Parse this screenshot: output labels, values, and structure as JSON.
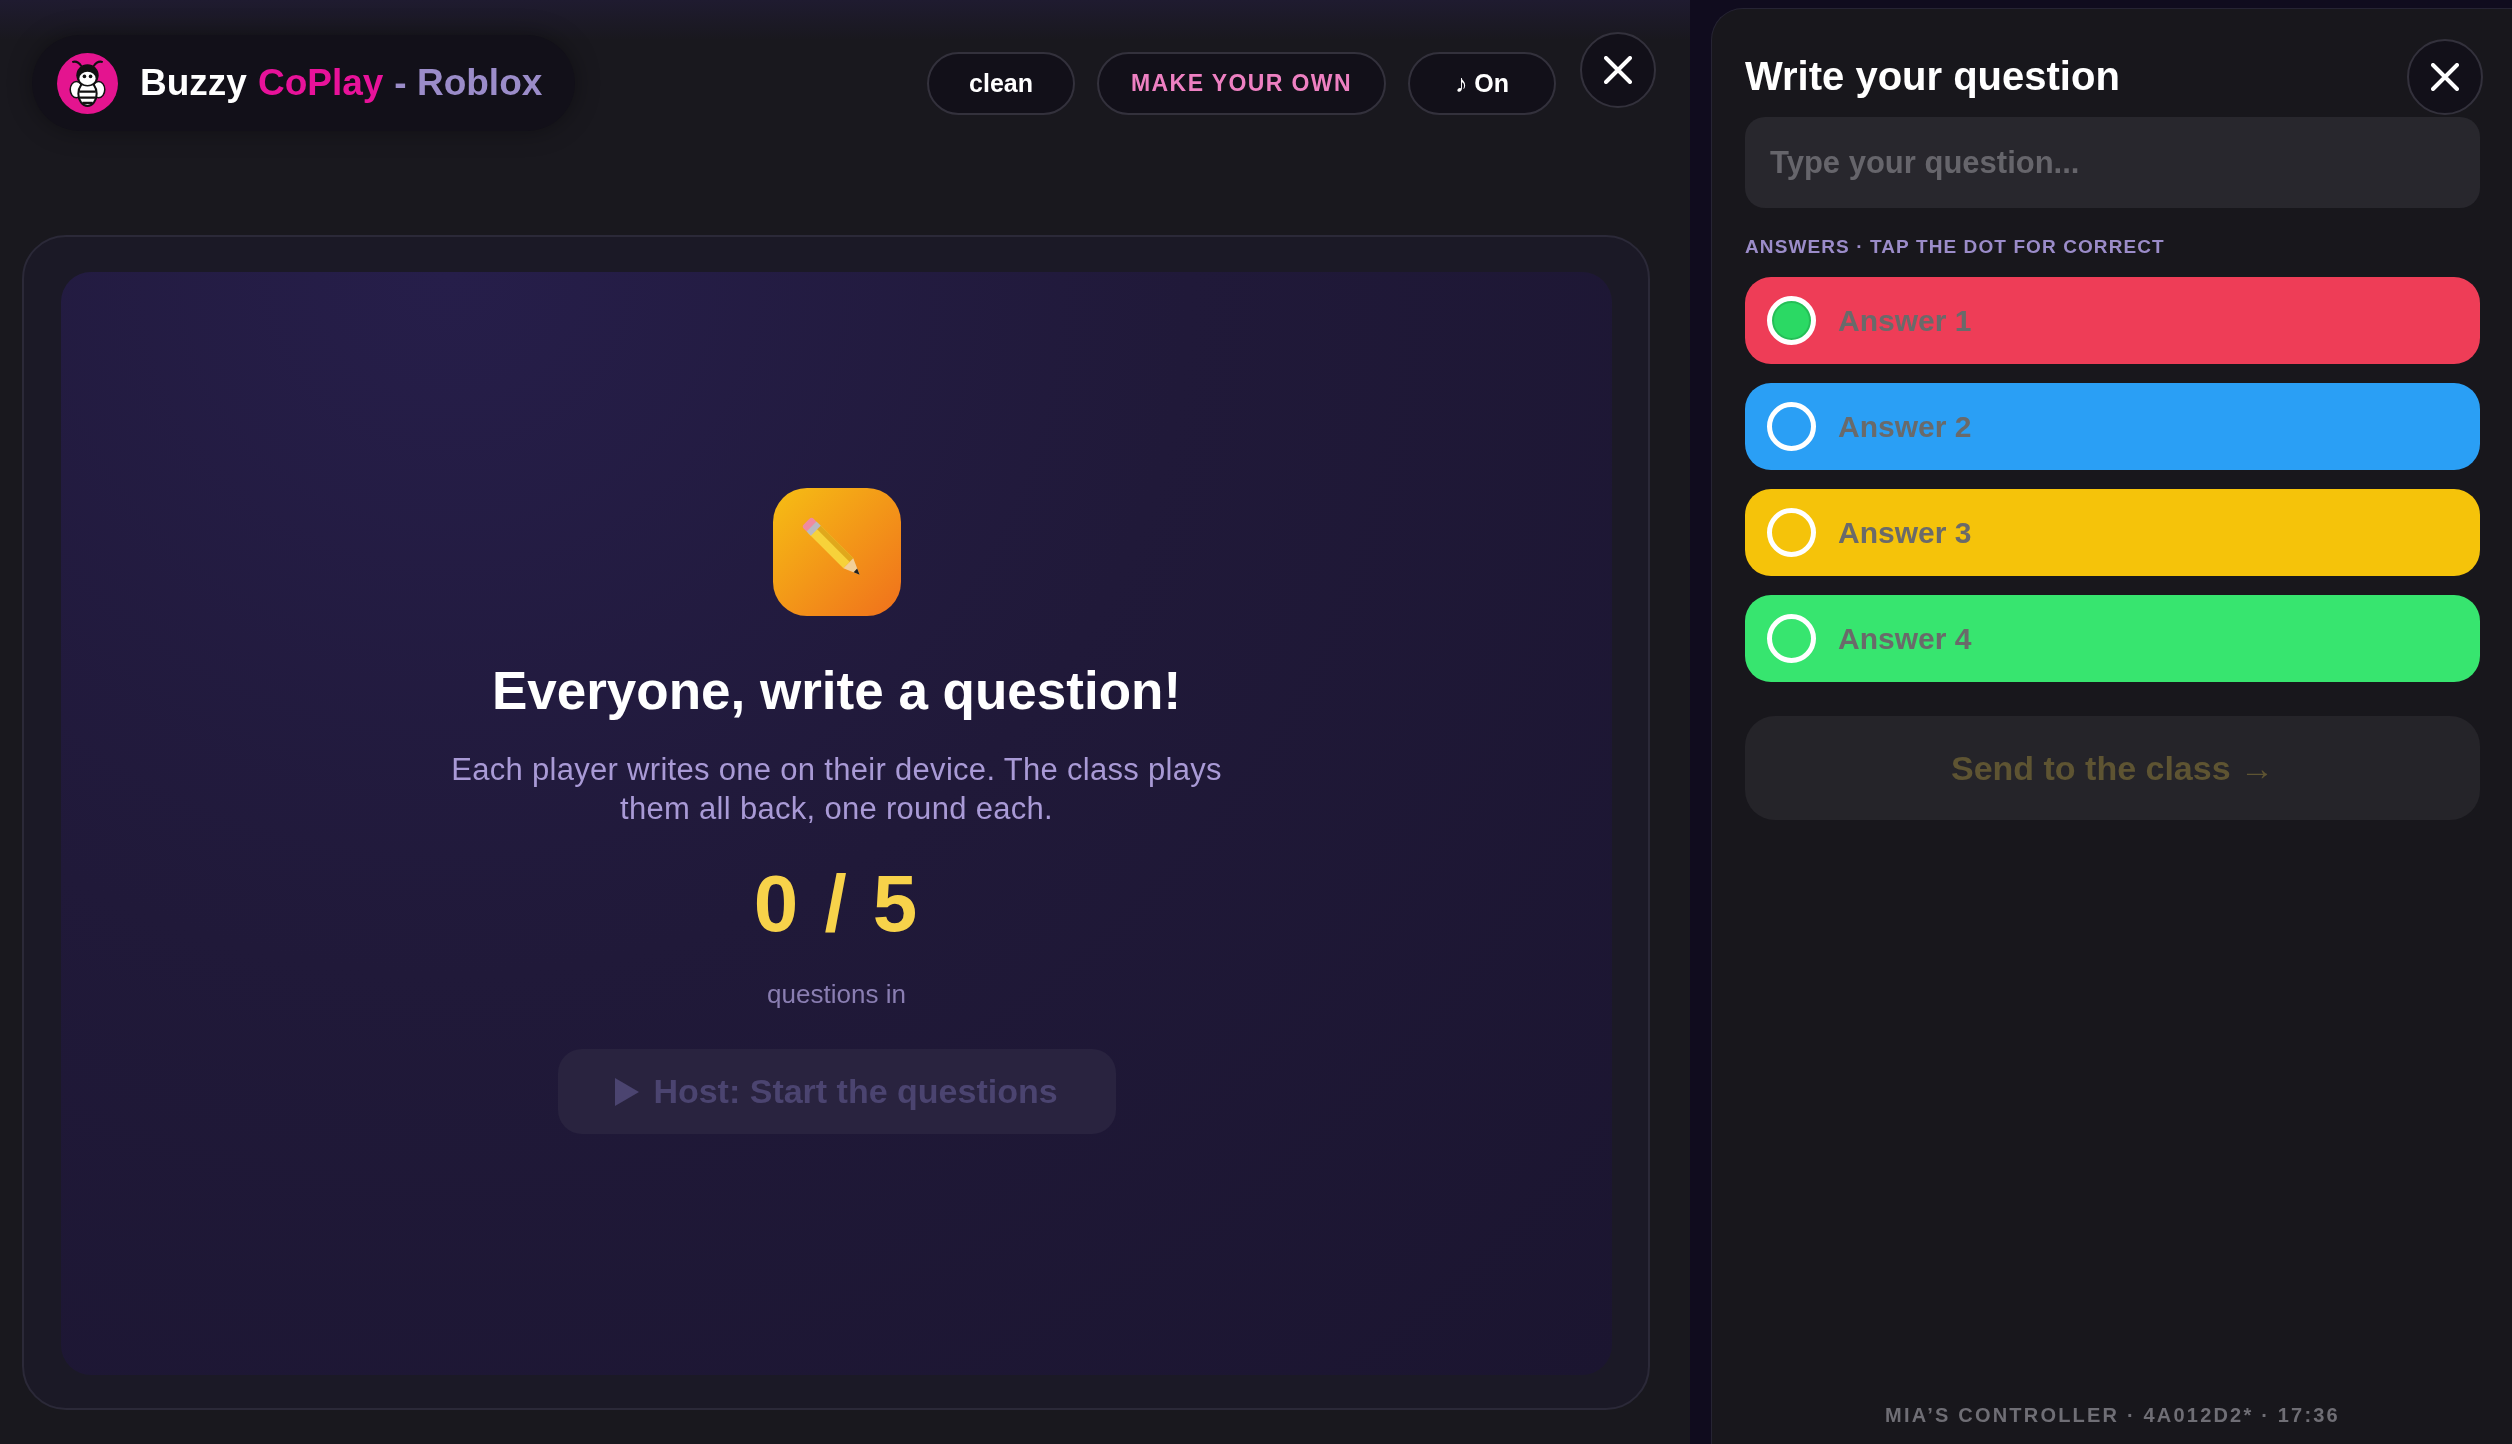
{
  "header": {
    "brand": {
      "name": "Buzzy",
      "accent": "CoPlay",
      "suffix": "- Roblox"
    },
    "buttons": [
      {
        "label": "clean",
        "kind": "plain"
      },
      {
        "label": "MAKE YOUR OWN",
        "kind": "accent"
      },
      {
        "label": "♪ On",
        "kind": "plain"
      }
    ]
  },
  "stage": {
    "title": "Everyone, write a question!",
    "description": "Each player writes one on their device. The class plays them all back, one round each.",
    "count": "0 / 5",
    "count_label": "questions in",
    "start_button": {
      "label": "Host: Start the questions",
      "disabled": true
    }
  },
  "panel": {
    "title": "Write your question",
    "question_field": {
      "placeholder": "Type your question..."
    },
    "answers_label": "ANSWERS · TAP THE DOT FOR CORRECT",
    "answers": [
      {
        "placeholder": "Answer 1",
        "color": "#ee3d57",
        "correct": true
      },
      {
        "placeholder": "Answer 2",
        "color": "#2a9ff5",
        "correct": false
      },
      {
        "placeholder": "Answer 3",
        "color": "#f5c30a",
        "correct": false
      },
      {
        "placeholder": "Answer 4",
        "color": "#37e56f",
        "correct": false
      }
    ],
    "send_button": {
      "label": "Send to the class →",
      "disabled": true
    },
    "footer": "MIA’S CONTROLLER · 4A012D2* · 17:36"
  }
}
